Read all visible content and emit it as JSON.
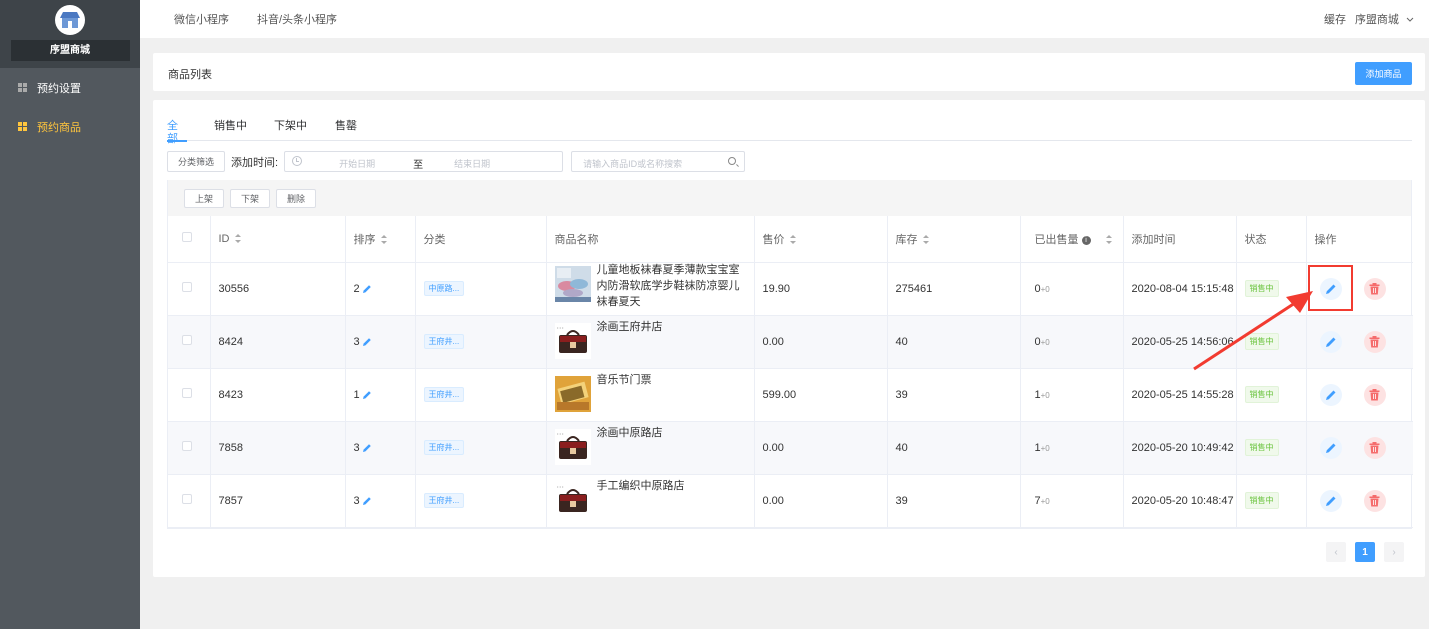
{
  "sidebar": {
    "shop_name": "序盟商城",
    "items": [
      {
        "label": "预约设置",
        "active": false
      },
      {
        "label": "预约商品",
        "active": true
      }
    ]
  },
  "topbar": {
    "links": [
      "微信小程序",
      "抖音/头条小程序"
    ],
    "cache": "缓存",
    "shop": "序盟商城"
  },
  "header": {
    "title": "商品列表",
    "add_button": "添加商品"
  },
  "tabs": [
    "全部",
    "销售中",
    "下架中",
    "售罄"
  ],
  "filter": {
    "category_button": "分类筛选",
    "add_time_label": "添加时间:",
    "start_placeholder": "开始日期",
    "separator": "至",
    "end_placeholder": "结束日期",
    "search_placeholder": "请输入商品ID或名称搜索"
  },
  "actions": {
    "on_shelf": "上架",
    "off_shelf": "下架",
    "delete": "删除"
  },
  "table": {
    "headers": {
      "id": "ID",
      "sort": "排序",
      "category": "分类",
      "name": "商品名称",
      "price": "售价",
      "stock": "库存",
      "sold": "已出售量",
      "time": "添加时间",
      "status": "状态",
      "ops": "操作"
    },
    "rows": [
      {
        "id": "30556",
        "sort": "2",
        "category": "中原路...",
        "name": "儿童地板袜春夏季薄款宝宝室内防滑软底学步鞋袜防凉婴儿袜春夏天",
        "price": "19.90",
        "stock": "275461",
        "sold": "0",
        "sold_extra": "+0",
        "time": "2020-08-04 15:15:48",
        "status": "销售中",
        "thumb": "socks"
      },
      {
        "id": "8424",
        "sort": "3",
        "category": "王府井...",
        "name": "涂画王府井店",
        "price": "0.00",
        "stock": "40",
        "sold": "0",
        "sold_extra": "+0",
        "time": "2020-05-25 14:56:06",
        "status": "销售中",
        "thumb": "bag"
      },
      {
        "id": "8423",
        "sort": "1",
        "category": "王府井...",
        "name": "音乐节门票",
        "price": "599.00",
        "stock": "39",
        "sold": "1",
        "sold_extra": "+0",
        "time": "2020-05-25 14:55:28",
        "status": "销售中",
        "thumb": "ticket"
      },
      {
        "id": "7858",
        "sort": "3",
        "category": "王府井...",
        "name": "涂画中原路店",
        "price": "0.00",
        "stock": "40",
        "sold": "1",
        "sold_extra": "+0",
        "time": "2020-05-20 10:49:42",
        "status": "销售中",
        "thumb": "bag"
      },
      {
        "id": "7857",
        "sort": "3",
        "category": "王府井...",
        "name": "手工编织中原路店",
        "price": "0.00",
        "stock": "39",
        "sold": "7",
        "sold_extra": "+0",
        "time": "2020-05-20 10:48:47",
        "status": "销售中",
        "thumb": "bag"
      }
    ]
  },
  "pagination": {
    "current": "1"
  },
  "colors": {
    "primary": "#409eff",
    "success": "#67c23a",
    "danger": "#f56c6c",
    "annotation": "#f23b30",
    "sidebar": "#52585e"
  }
}
